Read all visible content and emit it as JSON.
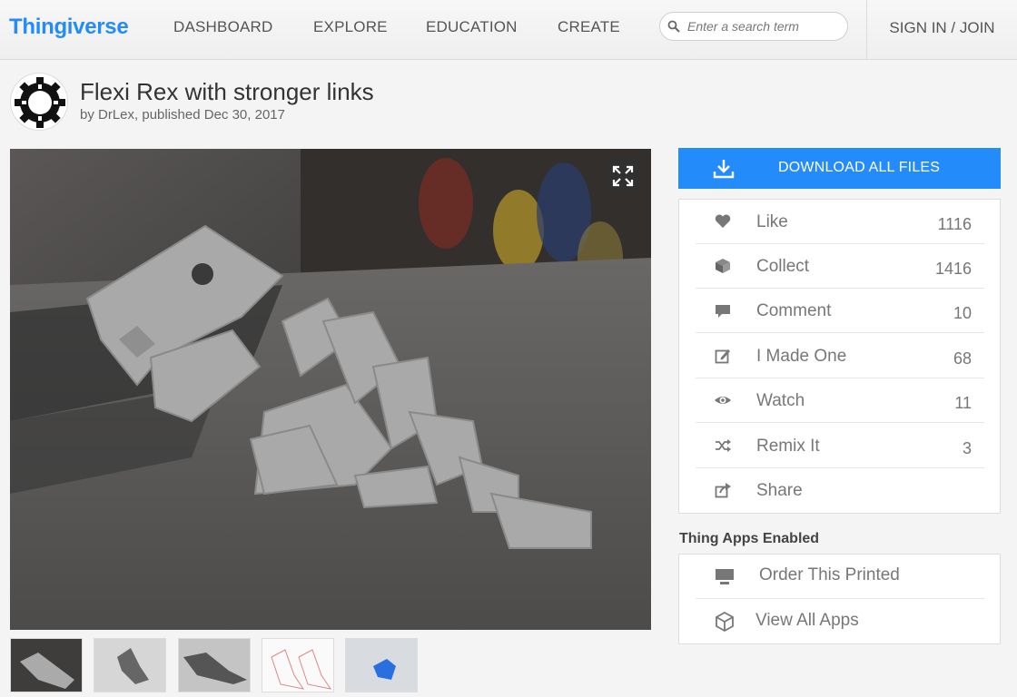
{
  "header": {
    "logo": "Thingiverse",
    "nav": [
      "DASHBOARD",
      "EXPLORE",
      "EDUCATION",
      "CREATE"
    ],
    "search_placeholder": "Enter a search term",
    "signin": "SIGN IN / JOIN"
  },
  "thing": {
    "title": "Flexi Rex with stronger links",
    "byline": "by DrLex, published Dec 30, 2017"
  },
  "download": {
    "label": "DOWNLOAD ALL FILES"
  },
  "actions": [
    {
      "label": "Like",
      "count": "1116",
      "icon": "heart-icon"
    },
    {
      "label": "Collect",
      "count": "1416",
      "icon": "cube-icon"
    },
    {
      "label": "Comment",
      "count": "10",
      "icon": "comment-icon"
    },
    {
      "label": "I Made One",
      "count": "68",
      "icon": "edit-icon"
    },
    {
      "label": "Watch",
      "count": "11",
      "icon": "eye-icon"
    },
    {
      "label": "Remix It",
      "count": "3",
      "icon": "shuffle-icon"
    },
    {
      "label": "Share",
      "count": "",
      "icon": "share-icon"
    }
  ],
  "apps": {
    "heading": "Thing Apps Enabled",
    "items": [
      {
        "label": "Order This Printed",
        "icon": "printer-icon"
      },
      {
        "label": "View All Apps",
        "icon": "box-icon"
      }
    ]
  },
  "colors": {
    "brand": "#248bfb",
    "download": "#248bfb"
  }
}
